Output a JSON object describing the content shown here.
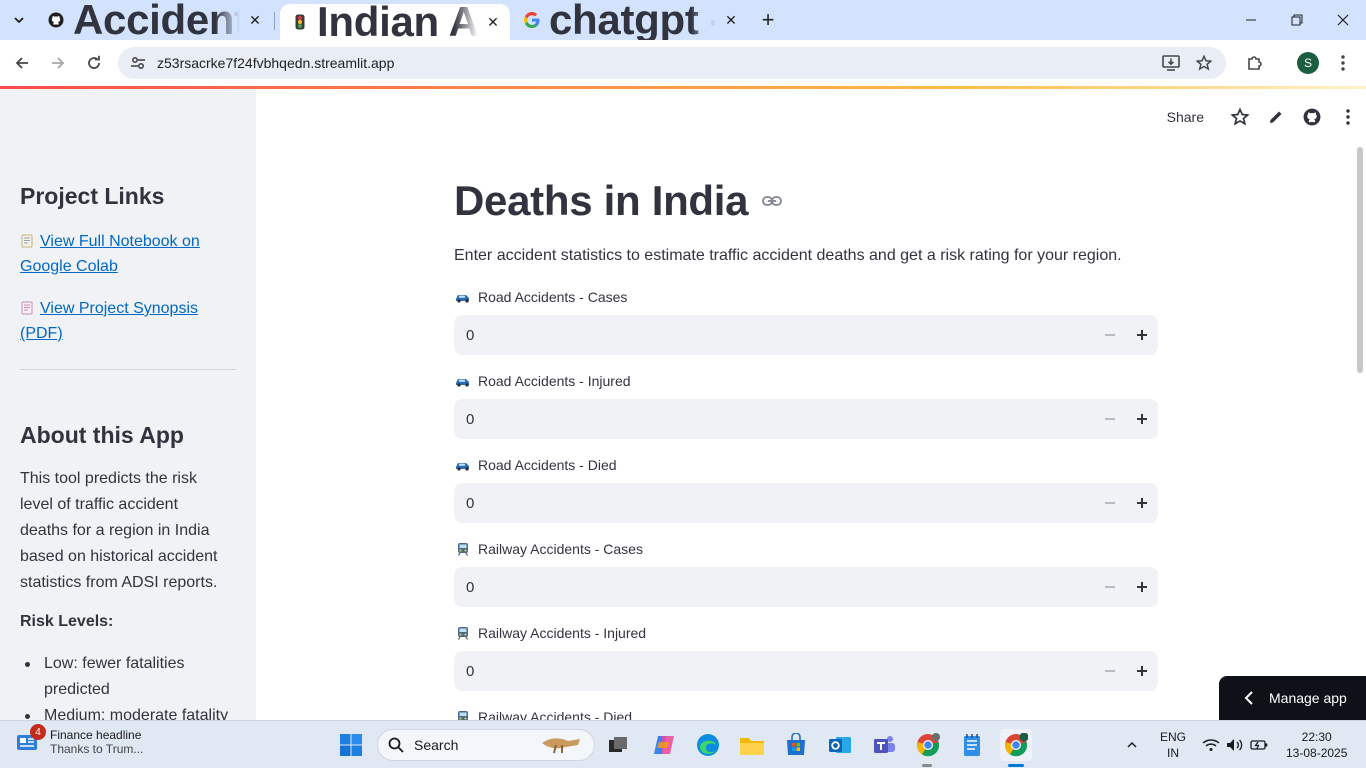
{
  "browser": {
    "tabs": [
      {
        "title": "Accidental--death-india-ml-/sa",
        "icon": "github-icon"
      },
      {
        "title": "Indian Accident Risk Predictor · Streamlit",
        "icon": "traffic-light-icon"
      },
      {
        "title": "chatgpt - Google Search",
        "icon": "google-icon"
      }
    ],
    "url": "z53rsacrke7f24fvbhqedn.streamlit.app",
    "profile_initial": "S"
  },
  "sidebar": {
    "links_heading": "Project Links",
    "links": [
      {
        "emoji": "notebook-icon",
        "label": "View Full Notebook on Google Colab"
      },
      {
        "emoji": "page-icon",
        "label": "View Project Synopsis (PDF)"
      }
    ],
    "about_heading": "About this App",
    "about_text": "This tool predicts the risk level of traffic accident deaths for a region in India based on historical accident statistics from ADSI reports.",
    "risk_heading": "Risk Levels:",
    "risk_items": [
      "Low: fewer fatalities predicted",
      "Medium: moderate fatality"
    ]
  },
  "header": {
    "share_label": "Share"
  },
  "main": {
    "title": "Deaths in India",
    "description": "Enter accident statistics to estimate traffic accident deaths and get a risk rating for your region.",
    "fields": [
      {
        "emoji": "car",
        "label": "Road Accidents - Cases",
        "value": "0"
      },
      {
        "emoji": "car",
        "label": "Road Accidents - Injured",
        "value": "0"
      },
      {
        "emoji": "car",
        "label": "Road Accidents - Died",
        "value": "0"
      },
      {
        "emoji": "train",
        "label": "Railway Accidents - Cases",
        "value": "0"
      },
      {
        "emoji": "train",
        "label": "Railway Accidents - Injured",
        "value": "0"
      },
      {
        "emoji": "train",
        "label": "Railway Accidents - Died",
        "value": ""
      }
    ]
  },
  "manage_app": {
    "label": "Manage app"
  },
  "taskbar": {
    "news_title": "Finance headline",
    "news_sub": "Thanks to Trum...",
    "news_badge": "4",
    "search_placeholder": "Search",
    "lang_line1": "ENG",
    "lang_line2": "IN",
    "time": "22:30",
    "date": "13-08-2025"
  },
  "colors": {
    "link": "#0068c9",
    "accent_red": "#ff4b4b",
    "sidebar_bg": "#f0f2f6",
    "manage_bg": "#0e1117",
    "tabstrip_bg": "#d3e3fd"
  }
}
